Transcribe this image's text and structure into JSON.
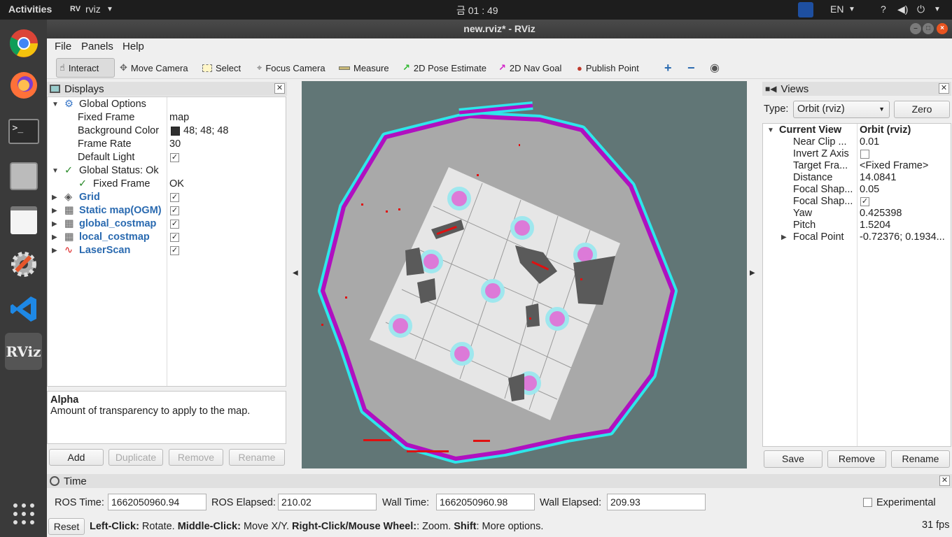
{
  "topbar": {
    "activities": "Activities",
    "app_name": "rviz",
    "clock": "금 01 : 49",
    "lang": "EN"
  },
  "window": {
    "title": "new.rviz* - RViz"
  },
  "menu": {
    "file": "File",
    "panels": "Panels",
    "help": "Help"
  },
  "toolbar": {
    "interact": "Interact",
    "move_camera": "Move Camera",
    "select": "Select",
    "focus_camera": "Focus Camera",
    "measure": "Measure",
    "pose_estimate": "2D Pose Estimate",
    "nav_goal": "2D Nav Goal",
    "publish_point": "Publish Point"
  },
  "displays": {
    "title": "Displays",
    "rows": [
      {
        "label": "Global Options",
        "value": ""
      },
      {
        "label": "Fixed Frame",
        "value": "map"
      },
      {
        "label": "Background Color",
        "value": "48; 48; 48"
      },
      {
        "label": "Frame Rate",
        "value": "30"
      },
      {
        "label": "Default Light",
        "value": ""
      },
      {
        "label": "Global Status: Ok",
        "value": ""
      },
      {
        "label": "Fixed Frame",
        "value": "OK"
      },
      {
        "label": "Grid",
        "value": ""
      },
      {
        "label": "Static map(OGM)",
        "value": ""
      },
      {
        "label": "global_costmap",
        "value": ""
      },
      {
        "label": "local_costmap",
        "value": ""
      },
      {
        "label": "LaserScan",
        "value": ""
      }
    ],
    "help_title": "Alpha",
    "help_text": "Amount of transparency to apply to the map.",
    "buttons": {
      "add": "Add",
      "duplicate": "Duplicate",
      "remove": "Remove",
      "rename": "Rename"
    }
  },
  "views": {
    "title": "Views",
    "type_label": "Type:",
    "type_value": "Orbit (rviz)",
    "zero": "Zero",
    "rows": [
      {
        "label": "Current View",
        "value": "Orbit (rviz)"
      },
      {
        "label": "Near Clip ...",
        "value": "0.01"
      },
      {
        "label": "Invert Z Axis",
        "value": ""
      },
      {
        "label": "Target Fra...",
        "value": "<Fixed Frame>"
      },
      {
        "label": "Distance",
        "value": "14.0841"
      },
      {
        "label": "Focal Shap...",
        "value": "0.05"
      },
      {
        "label": "Focal Shap...",
        "value": ""
      },
      {
        "label": "Yaw",
        "value": "0.425398"
      },
      {
        "label": "Pitch",
        "value": "1.5204"
      },
      {
        "label": "Focal Point",
        "value": "-0.72376; 0.1934..."
      }
    ],
    "buttons": {
      "save": "Save",
      "remove": "Remove",
      "rename": "Rename"
    }
  },
  "time": {
    "title": "Time",
    "ros_time_label": "ROS Time:",
    "ros_time": "1662050960.94",
    "ros_elapsed_label": "ROS Elapsed:",
    "ros_elapsed": "210.02",
    "wall_time_label": "Wall Time:",
    "wall_time": "1662050960.98",
    "wall_elapsed_label": "Wall Elapsed:",
    "wall_elapsed": "209.93",
    "experimental": "Experimental"
  },
  "status": {
    "reset": "Reset",
    "left_click": "Left-Click:",
    "left_click_desc": " Rotate. ",
    "middle_click": "Middle-Click:",
    "middle_click_desc": " Move X/Y. ",
    "right_click": "Right-Click/Mouse Wheel:",
    "right_click_desc": ": Zoom. ",
    "shift": "Shift",
    "shift_desc": ": More options.",
    "fps": "31 fps"
  }
}
